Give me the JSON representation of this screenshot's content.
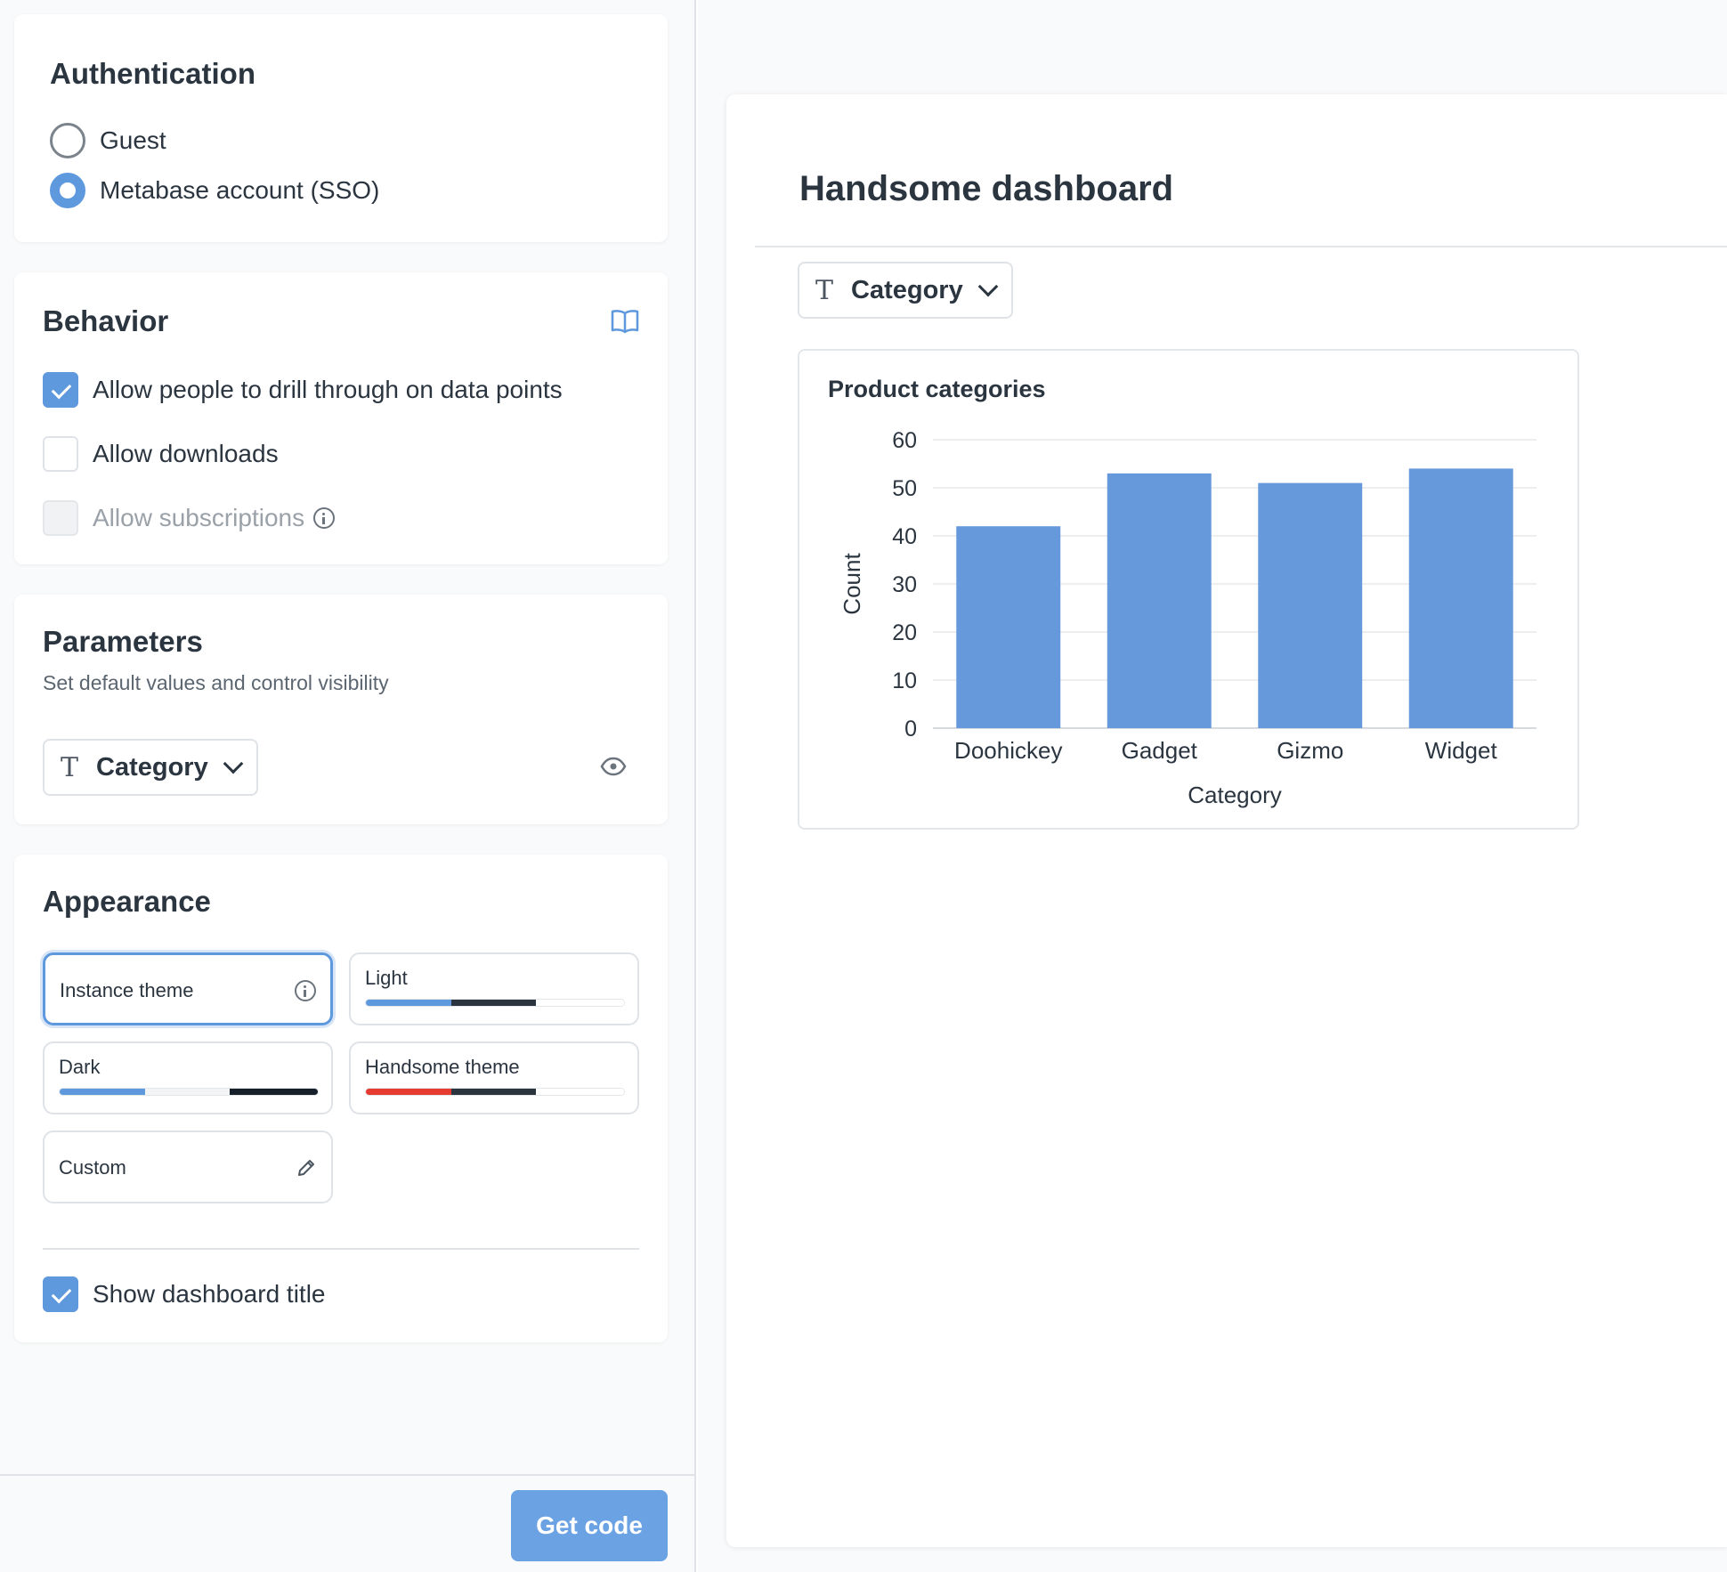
{
  "authentication": {
    "title": "Authentication",
    "options": [
      {
        "label": "Guest",
        "selected": false
      },
      {
        "label": "Metabase account (SSO)",
        "selected": true
      }
    ]
  },
  "behavior": {
    "title": "Behavior",
    "docs_icon": "book-icon",
    "options": [
      {
        "label": "Allow people to drill through on data points",
        "checked": true,
        "disabled": false
      },
      {
        "label": "Allow downloads",
        "checked": false,
        "disabled": false
      },
      {
        "label": "Allow subscriptions",
        "checked": false,
        "disabled": true
      }
    ]
  },
  "parameters": {
    "title": "Parameters",
    "subtitle": "Set default values and control visibility",
    "filter": {
      "icon": "text-type-icon",
      "label": "Category"
    },
    "visibility_icon": "eye-icon"
  },
  "appearance": {
    "title": "Appearance",
    "themes": [
      {
        "name": "Instance theme",
        "selected": true,
        "icon": "info-icon"
      },
      {
        "name": "Light",
        "selected": false,
        "colors": [
          "#5e98dd",
          "#2b3540",
          "#ffffff"
        ]
      },
      {
        "name": "Dark",
        "selected": false,
        "colors": [
          "#5e98dd",
          "#f3f4f5",
          "#15202b"
        ]
      },
      {
        "name": "Handsome theme",
        "selected": false,
        "colors": [
          "#e53b30",
          "#2b3540",
          "#ffffff"
        ]
      },
      {
        "name": "Custom",
        "selected": false,
        "icon": "pencil-icon"
      }
    ],
    "show_title": {
      "label": "Show dashboard title",
      "checked": true
    }
  },
  "footer": {
    "get_code_label": "Get code"
  },
  "preview": {
    "dashboard_title": "Handsome dashboard",
    "filter": {
      "icon": "text-type-icon",
      "label": "Category"
    },
    "card_title": "Product categories"
  },
  "colors": {
    "accent": "#5e98dd",
    "bar": "#6699db",
    "text": "#2b3540"
  },
  "chart_data": {
    "type": "bar",
    "title": "Product categories",
    "categories": [
      "Doohickey",
      "Gadget",
      "Gizmo",
      "Widget"
    ],
    "values": [
      42,
      53,
      51,
      54
    ],
    "xlabel": "Category",
    "ylabel": "Count",
    "ylim": [
      0,
      60
    ],
    "yticks": [
      0,
      10,
      20,
      30,
      40,
      50,
      60
    ],
    "grid": true
  }
}
